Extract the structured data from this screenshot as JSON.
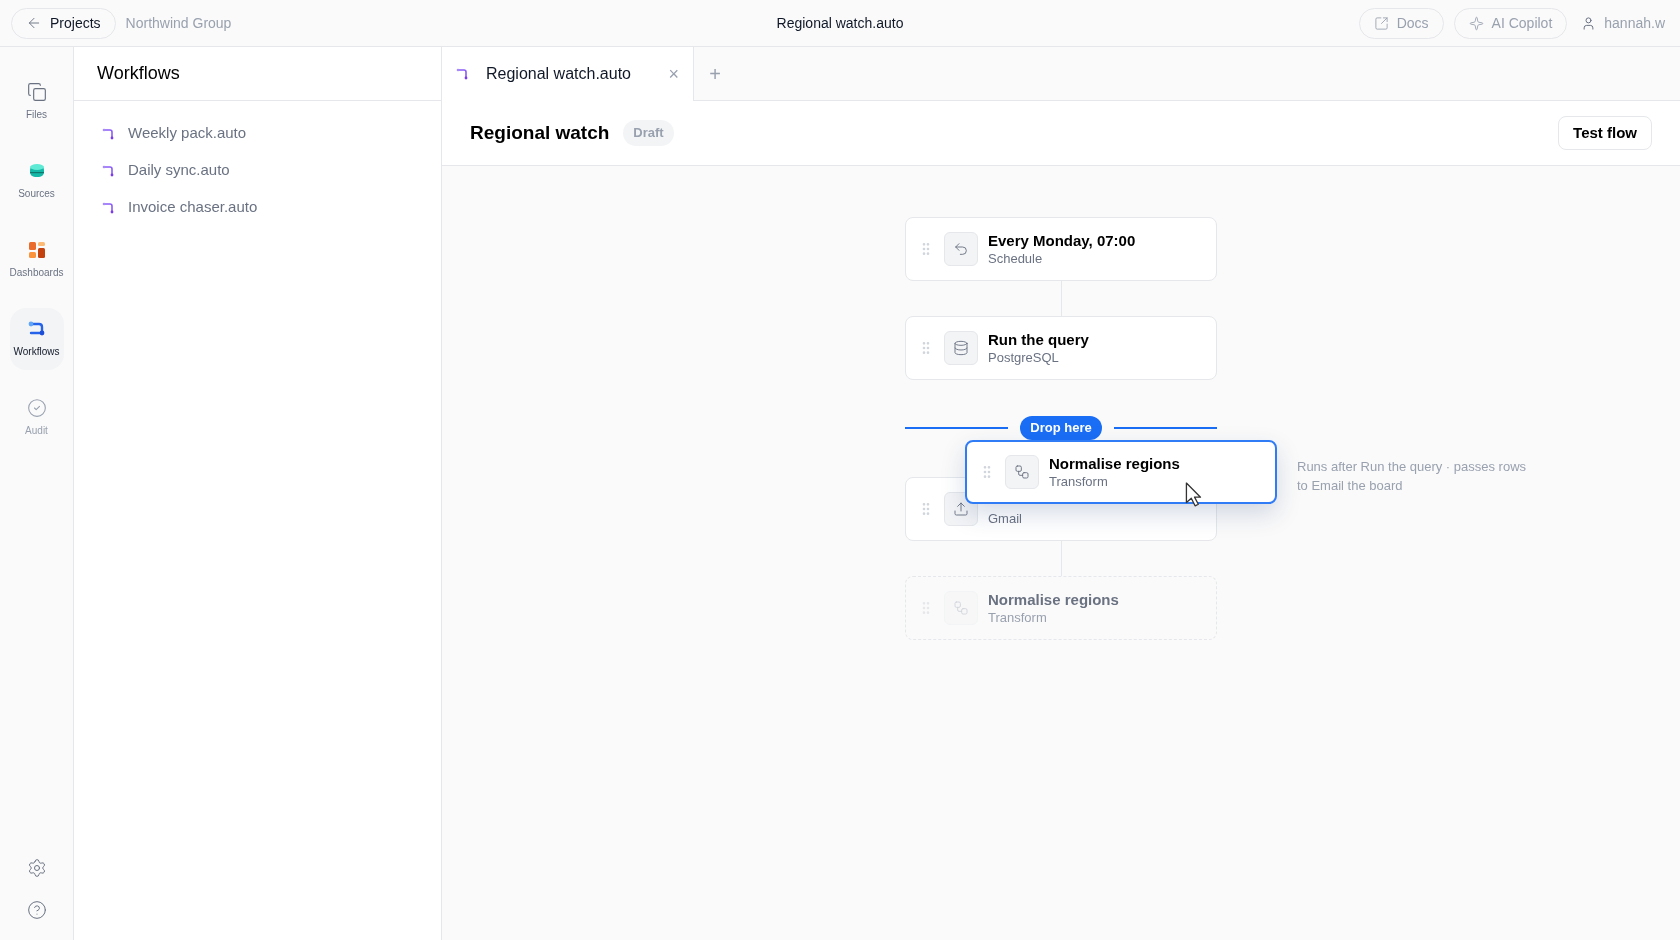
{
  "top_bar": {
    "back_button": "Projects",
    "breadcrumb": "Northwind Group",
    "title": "Regional watch.auto",
    "actions": [
      "Docs",
      "AI Copilot"
    ],
    "user": "hannah.w"
  },
  "rail": {
    "items": [
      {
        "label": "Files",
        "kind": "files",
        "selected": false,
        "disabled": false
      },
      {
        "label": "Sources",
        "kind": "sources",
        "selected": false,
        "disabled": false
      },
      {
        "label": "Dashboards",
        "kind": "dashboards",
        "selected": false,
        "disabled": false
      },
      {
        "label": "Workflows",
        "kind": "workflows",
        "selected": true,
        "disabled": false
      },
      {
        "label": "Audit",
        "kind": "audit",
        "selected": false,
        "disabled": true
      }
    ]
  },
  "panel": {
    "title": "Workflows",
    "items": [
      "Weekly pack.auto",
      "Daily sync.auto",
      "Invoice chaser.auto"
    ]
  },
  "tabs": [
    {
      "label": "Regional watch.auto",
      "selected": true,
      "close": "×"
    }
  ],
  "new_tab": "+",
  "header": {
    "title": "Regional watch",
    "badge": "Draft",
    "button": "Test flow"
  },
  "canvas": {
    "steps": [
      {
        "kind": "schedule",
        "placeholder": false,
        "title": "Every Monday, 07:00",
        "subtitle": "Schedule"
      },
      {
        "kind": "database",
        "placeholder": false,
        "title": "Run the query",
        "subtitle": "PostgreSQL"
      },
      {
        "kind": "drop",
        "label": "Drop here"
      },
      {
        "kind": "email",
        "placeholder": false,
        "subtitle": "Gmail"
      },
      {
        "kind": "transform",
        "placeholder": true,
        "title": "Normalise regions",
        "subtitle": "Transform"
      }
    ],
    "dragging": {
      "kind": "transform",
      "title": "Normalise regions",
      "subtitle": "Transform",
      "note": "Runs after Run the query · passes rows to Email the board"
    }
  }
}
